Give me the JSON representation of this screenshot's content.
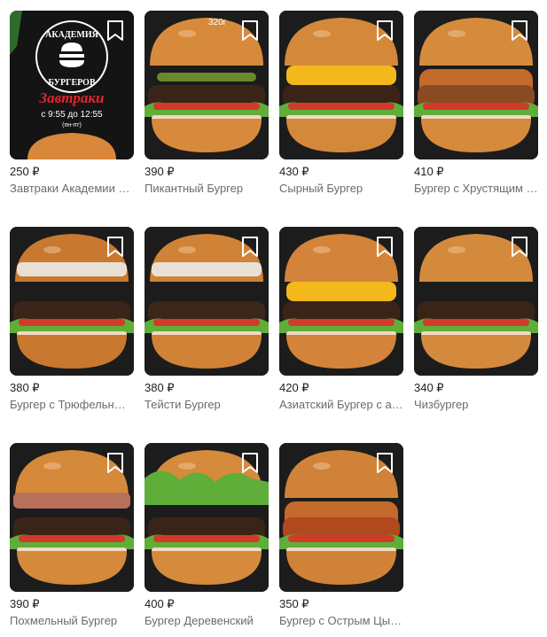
{
  "currency": "₽",
  "products": [
    {
      "price": "250 ₽",
      "title": "Завтраки Академии Бургеров",
      "image": "promo",
      "promo": {
        "brand_top": "АКАДЕМИЯ",
        "brand_bottom": "БУРГЕРОВ",
        "headline": "Завтраки",
        "hours": "с 9:55 до 12:55",
        "days": "(пн-пт)"
      }
    },
    {
      "price": "390 ₽",
      "title": "Пикантный Бургер",
      "image": "burger",
      "weight": "320г"
    },
    {
      "price": "430 ₽",
      "title": "Сырный Бургер",
      "image": "burger"
    },
    {
      "price": "410 ₽",
      "title": "Бургер с Хрустящим цыпленком",
      "image": "burger"
    },
    {
      "price": "380 ₽",
      "title": "Бургер с Трюфельным соусом",
      "image": "burger"
    },
    {
      "price": "380 ₽",
      "title": "Тейсти Бургер",
      "image": "burger"
    },
    {
      "price": "420 ₽",
      "title": "Азиатский Бургер с ананасом",
      "image": "burger"
    },
    {
      "price": "340 ₽",
      "title": "Чизбургер",
      "image": "burger"
    },
    {
      "price": "390 ₽",
      "title": "Похмельный Бургер",
      "image": "burger"
    },
    {
      "price": "400 ₽",
      "title": "Бургер Деревенский",
      "image": "burger"
    },
    {
      "price": "350 ₽",
      "title": "Бургер с Острым Цыпленком",
      "image": "burger"
    }
  ],
  "colors": {
    "bun": "#d9873a",
    "patty": "#3a2418",
    "lettuce": "#5fae3a",
    "tomato": "#d23a2a",
    "cheese": "#f2b81c",
    "sauce": "#f0d9c0",
    "promo_red": "#e0262b",
    "background": "#1c1c1c"
  },
  "icons": {
    "bookmark": "bookmark-icon"
  }
}
